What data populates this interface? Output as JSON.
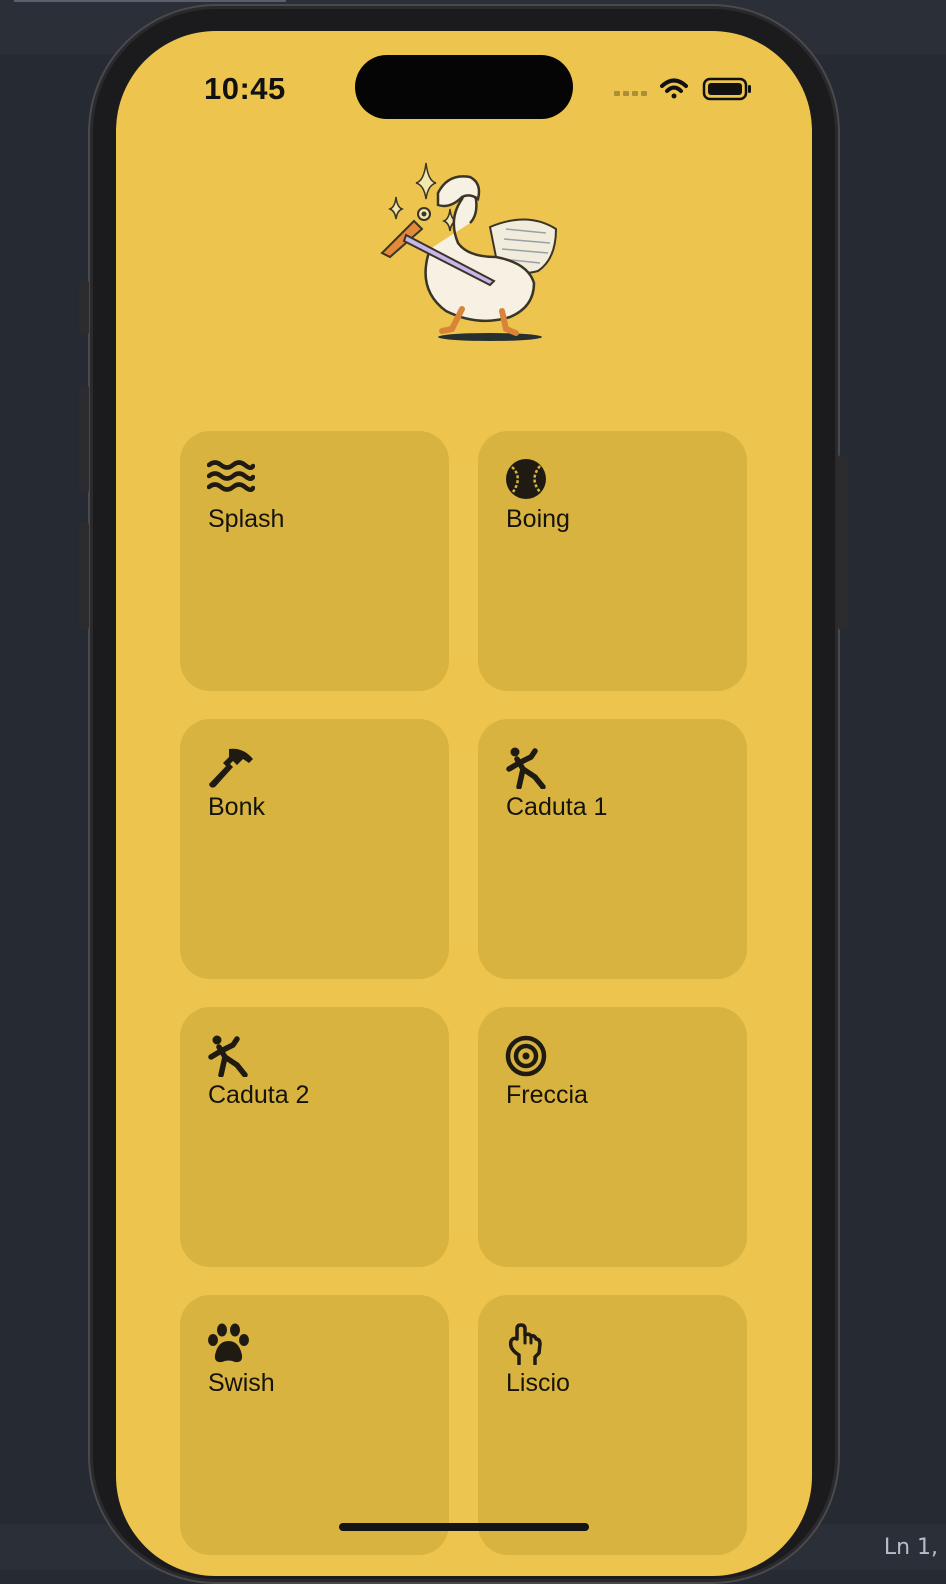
{
  "editor": {
    "status": "Ln 1,"
  },
  "status_bar": {
    "time": "10:45"
  },
  "colors": {
    "screen_bg": "#edc54e",
    "tile_bg": "#d8b340",
    "text": "#15130c"
  },
  "hero": {
    "icon": "goose-with-knife-illustration"
  },
  "sounds": [
    {
      "label": "Splash",
      "icon": "waves-icon"
    },
    {
      "label": "Boing",
      "icon": "baseball-icon"
    },
    {
      "label": "Bonk",
      "icon": "hammer-icon"
    },
    {
      "label": "Caduta 1",
      "icon": "person-falling-icon"
    },
    {
      "label": "Caduta 2",
      "icon": "person-falling-icon"
    },
    {
      "label": "Freccia",
      "icon": "target-icon"
    },
    {
      "label": "Swish",
      "icon": "paw-icon"
    },
    {
      "label": "Liscio",
      "icon": "hand-point-up-icon"
    }
  ]
}
